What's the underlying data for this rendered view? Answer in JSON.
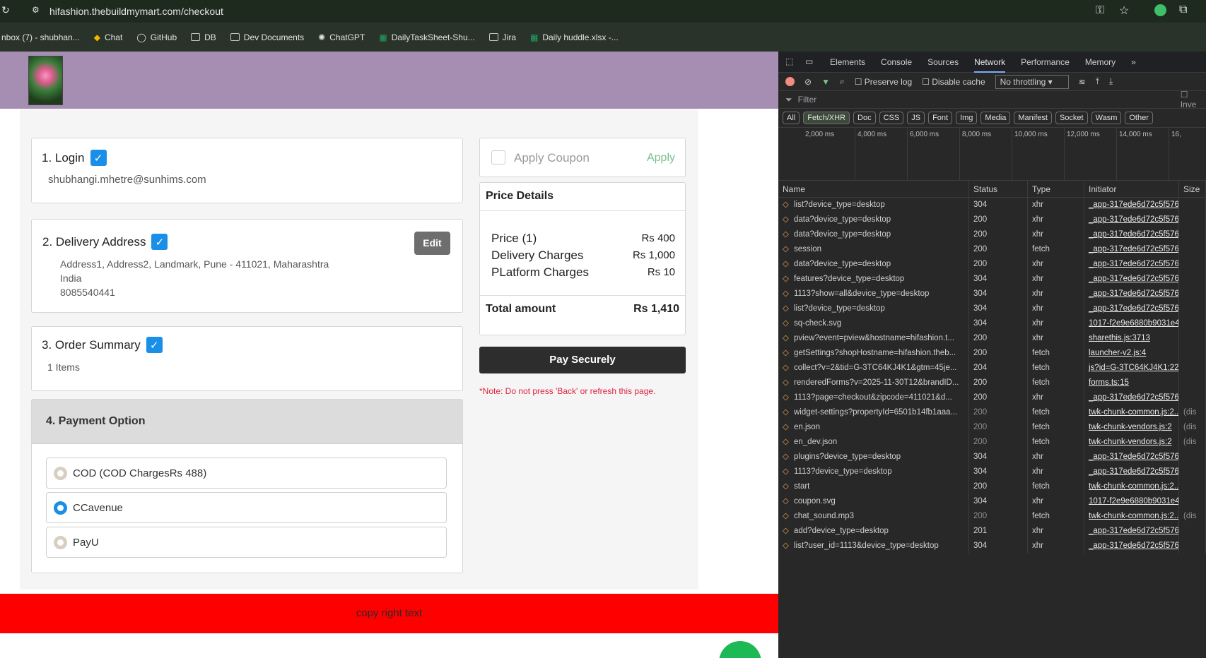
{
  "browser": {
    "url": "hifashion.thebuildmymart.com/checkout",
    "bookmarks": [
      "nbox (7) - shubhan...",
      "Chat",
      "GitHub",
      "DB",
      "Dev Documents",
      "ChatGPT",
      "DailyTaskSheet-Shu...",
      "Jira",
      "Daily huddle.xlsx -..."
    ]
  },
  "checkout": {
    "login": {
      "title": "1. Login",
      "email": "shubhangi.mhetre@sunhims.com"
    },
    "delivery": {
      "title": "2. Delivery Address",
      "edit": "Edit",
      "line1": "Address1, Address2, Landmark, Pune - 411021, Maharashtra",
      "line2": "India",
      "phone": "8085540441"
    },
    "summary": {
      "title": "3. Order Summary",
      "items": "1 Items"
    },
    "payment": {
      "title": "4. Payment Option",
      "options": [
        "COD (COD ChargesRs 488)",
        "CCavenue",
        "PayU"
      ],
      "selected_index": 1
    },
    "coupon": {
      "label": "Apply Coupon",
      "apply": "Apply"
    },
    "price": {
      "title": "Price Details",
      "rows": [
        {
          "label": "Price (1)",
          "value": "Rs 400"
        },
        {
          "label": "Delivery Charges",
          "value": "Rs 1,000"
        },
        {
          "label": "PLatform Charges",
          "value": "Rs 10"
        }
      ],
      "total_label": "Total amount",
      "total_value": "Rs 1,410"
    },
    "pay_button": "Pay Securely",
    "note": "*Note: Do not press 'Back' or refresh this page.",
    "footer": "copy right text"
  },
  "devtools": {
    "tabs": [
      "Elements",
      "Console",
      "Sources",
      "Network",
      "Performance",
      "Memory"
    ],
    "toolbar": {
      "preserve_log": "Preserve log",
      "disable_cache": "Disable cache",
      "throttling": "No throttling"
    },
    "filter_placeholder": "Filter",
    "invert": "Inve",
    "chips": [
      "All",
      "Fetch/XHR",
      "Doc",
      "CSS",
      "JS",
      "Font",
      "Img",
      "Media",
      "Manifest",
      "Socket",
      "Wasm",
      "Other"
    ],
    "timeline_ticks": [
      "2,000 ms",
      "4,000 ms",
      "6,000 ms",
      "8,000 ms",
      "10,000 ms",
      "12,000 ms",
      "14,000 ms",
      "16,"
    ],
    "columns": [
      "Name",
      "Status",
      "Type",
      "Initiator",
      "Size"
    ],
    "requests": [
      [
        "list?device_type=desktop",
        "304",
        "xhr",
        "_app-317ede6d72c5f576",
        ""
      ],
      [
        "data?device_type=desktop",
        "200",
        "xhr",
        "_app-317ede6d72c5f576",
        ""
      ],
      [
        "data?device_type=desktop",
        "200",
        "xhr",
        "_app-317ede6d72c5f576",
        ""
      ],
      [
        "session",
        "200",
        "fetch",
        "_app-317ede6d72c5f576",
        ""
      ],
      [
        "data?device_type=desktop",
        "200",
        "xhr",
        "_app-317ede6d72c5f576",
        ""
      ],
      [
        "features?device_type=desktop",
        "304",
        "xhr",
        "_app-317ede6d72c5f576",
        ""
      ],
      [
        "1113?show=all&device_type=desktop",
        "304",
        "xhr",
        "_app-317ede6d72c5f576",
        ""
      ],
      [
        "list?device_type=desktop",
        "304",
        "xhr",
        "_app-317ede6d72c5f576",
        ""
      ],
      [
        "sq-check.svg",
        "304",
        "xhr",
        "1017-f2e9e6880b9031e4",
        ""
      ],
      [
        "pview?event=pview&hostname=hifashion.t...",
        "200",
        "xhr",
        "sharethis.js:3713",
        ""
      ],
      [
        "getSettings?shopHostname=hifashion.theb...",
        "200",
        "fetch",
        "launcher-v2.js:4",
        ""
      ],
      [
        "collect?v=2&tid=G-3TC64KJ4K1&gtm=45je...",
        "204",
        "fetch",
        "js?id=G-3TC64KJ4K1:220",
        ""
      ],
      [
        "renderedForms?v=2025-11-30T12&brandID...",
        "200",
        "fetch",
        "forms.ts:15",
        ""
      ],
      [
        "1113?page=checkout&zipcode=411021&d...",
        "200",
        "xhr",
        "_app-317ede6d72c5f576",
        ""
      ],
      [
        "widget-settings?propertyId=6501b14fb1aaa...",
        "200",
        "fetch",
        "twk-chunk-common.js:2...",
        "(dis"
      ],
      [
        "en.json",
        "200",
        "fetch",
        "twk-chunk-vendors.js:2",
        "(dis"
      ],
      [
        "en_dev.json",
        "200",
        "fetch",
        "twk-chunk-vendors.js:2",
        "(dis"
      ],
      [
        "plugins?device_type=desktop",
        "304",
        "xhr",
        "_app-317ede6d72c5f576",
        ""
      ],
      [
        "1113?device_type=desktop",
        "304",
        "xhr",
        "_app-317ede6d72c5f576",
        ""
      ],
      [
        "start",
        "200",
        "fetch",
        "twk-chunk-common.js:2...",
        ""
      ],
      [
        "coupon.svg",
        "304",
        "xhr",
        "1017-f2e9e6880b9031e4",
        ""
      ],
      [
        "chat_sound.mp3",
        "200",
        "fetch",
        "twk-chunk-common.js:2...",
        "(dis"
      ],
      [
        "add?device_type=desktop",
        "201",
        "xhr",
        "_app-317ede6d72c5f576",
        ""
      ],
      [
        "list?user_id=1113&device_type=desktop",
        "304",
        "xhr",
        "_app-317ede6d72c5f576",
        ""
      ]
    ]
  }
}
